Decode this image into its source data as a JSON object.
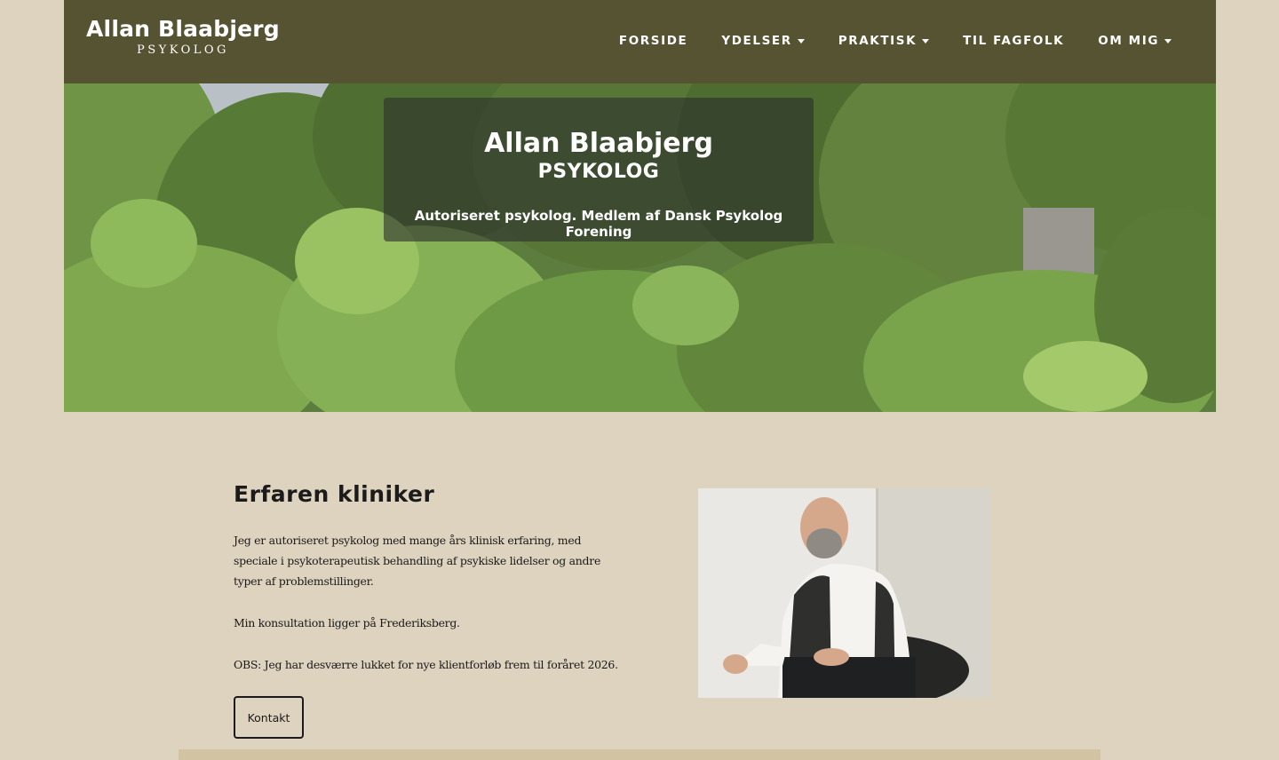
{
  "header": {
    "logo_name": "Allan Blaabjerg",
    "logo_sub": "PSYKOLOG",
    "nav": [
      {
        "label": "FORSIDE",
        "dropdown": false
      },
      {
        "label": "YDELSER",
        "dropdown": true
      },
      {
        "label": "PRAKTISK",
        "dropdown": true
      },
      {
        "label": "TIL FAGFOLK",
        "dropdown": false
      },
      {
        "label": "OM MIG",
        "dropdown": true
      }
    ]
  },
  "hero": {
    "title": "Allan Blaabjerg",
    "subtitle": "PSYKOLOG",
    "tagline": "Autoriseret psykolog. Medlem af Dansk Psykolog Forening"
  },
  "intro": {
    "heading": "Erfaren kliniker",
    "paragraphs": [
      "Jeg er autoriseret psykolog med mange års klinisk erfaring, med speciale i psykoterapeutisk behandling af psykiske lidelser og andre typer af problemstillinger.",
      "Min konsultation ligger på Frederiksberg.",
      "OBS: Jeg har desværre lukket for nye klientforløb frem til foråret 2026."
    ],
    "button_label": "Kontakt"
  },
  "colors": {
    "page_bg": "#ded3bf",
    "header_bg": "#555331",
    "band": "#d2c3a3"
  }
}
